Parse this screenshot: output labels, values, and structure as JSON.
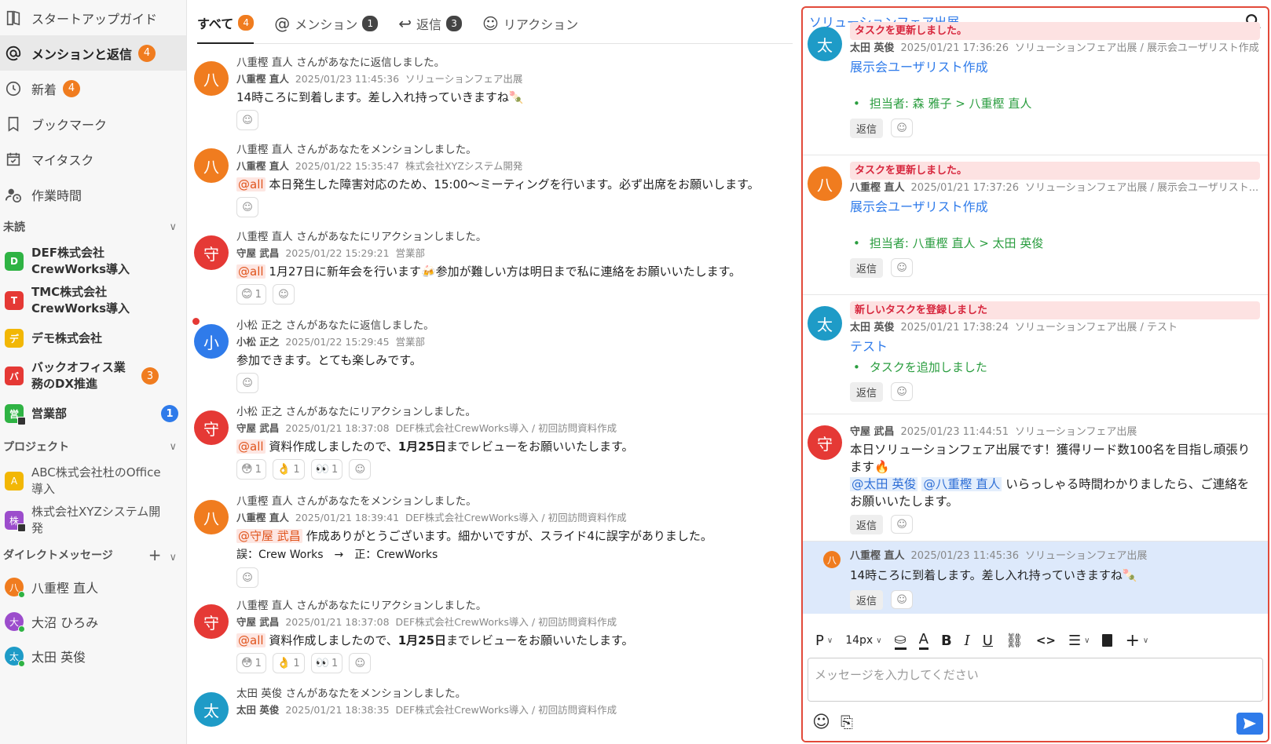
{
  "sidebar": {
    "nav": [
      {
        "label": "スタートアップガイド",
        "icon": "book-icon"
      },
      {
        "label": "メンションと返信",
        "icon": "at-icon",
        "badge": "4",
        "active": true
      },
      {
        "label": "新着",
        "icon": "clock-icon",
        "badge": "4"
      },
      {
        "label": "ブックマーク",
        "icon": "bookmark-icon"
      },
      {
        "label": "マイタスク",
        "icon": "calendar-check-icon"
      },
      {
        "label": "作業時間",
        "icon": "user-clock-icon"
      }
    ],
    "unread_section": "未読",
    "unread_channels": [
      {
        "initial": "D",
        "color": "#2fb344",
        "label": "DEF株式会社CrewWorks導入"
      },
      {
        "initial": "T",
        "color": "#e53935",
        "label": "TMC株式会社CrewWorks導入"
      },
      {
        "initial": "デ",
        "color": "#f2b705",
        "label": "デモ株式会社"
      },
      {
        "initial": "バ",
        "color": "#e53935",
        "label": "バックオフィス業務のDX推進",
        "badge": "3"
      },
      {
        "initial": "営",
        "color": "#2fb344",
        "label": "営業部",
        "badge_blue": "1",
        "locked": true
      }
    ],
    "project_section": "プロジェクト",
    "projects": [
      {
        "initial": "A",
        "color": "#f2b705",
        "label": "ABC株式会社杜のOffice導入"
      },
      {
        "initial": "株",
        "color": "#9c4dcc",
        "label": "株式会社XYZシステム開発",
        "locked": true
      }
    ],
    "dm_section": "ダイレクトメッセージ",
    "dms": [
      {
        "initial": "八",
        "color": "#f07c1f",
        "label": "八重樫 直人",
        "online": true
      },
      {
        "initial": "大",
        "color": "#9c4dcc",
        "label": "大沼 ひろみ",
        "online": true
      },
      {
        "initial": "太",
        "color": "#1e9bc7",
        "label": "太田 英俊",
        "online": true
      }
    ]
  },
  "tabs": [
    {
      "label": "すべて",
      "badge": "4",
      "icon": "",
      "active": true
    },
    {
      "label": "メンション",
      "badge": "1",
      "icon": "@"
    },
    {
      "label": "返信",
      "badge": "3",
      "icon": "↩"
    },
    {
      "label": "リアクション",
      "badge": "",
      "icon": "☺"
    }
  ],
  "feed": [
    {
      "avatar": "八",
      "color": "#f07c1f",
      "head": "八重樫 直人 さんがあなたに返信しました。",
      "author": "八重樫 直人",
      "date": "2025/01/23 11:45:36",
      "channel": "ソリューションフェア出展",
      "mention": "",
      "body": "14時ころに到着します。差し入れ持っていきますね🍡",
      "reactions": []
    },
    {
      "avatar": "八",
      "color": "#f07c1f",
      "head": "八重樫 直人 さんがあなたをメンションしました。",
      "author": "八重樫 直人",
      "date": "2025/01/22 15:35:47",
      "channel": "株式会社XYZシステム開発",
      "mention": "@all",
      "body": "本日発生した障害対応のため、15:00～ミーティングを行います。必ず出席をお願いします。",
      "reactions": []
    },
    {
      "avatar": "守",
      "color": "#e53935",
      "head": "八重樫 直人 さんがあなたにリアクションしました。",
      "author": "守屋 武昌",
      "date": "2025/01/22 15:29:21",
      "channel": "営業部",
      "mention": "@all",
      "body": "1月27日に新年会を行います🍻参加が難しい方は明日まで私に連絡をお願いいたします。",
      "reactions": [
        {
          "emoji": "😊",
          "count": "1"
        }
      ]
    },
    {
      "avatar": "小",
      "color": "#2f7bea",
      "unread": true,
      "head": "小松 正之 さんがあなたに返信しました。",
      "author": "小松 正之",
      "date": "2025/01/22 15:29:45",
      "channel": "営業部",
      "mention": "",
      "body": "参加できます。とても楽しみです。",
      "reactions": []
    },
    {
      "avatar": "守",
      "color": "#e53935",
      "head": "小松 正之 さんがあなたにリアクションしました。",
      "author": "守屋 武昌",
      "date": "2025/01/21 18:37:08",
      "channel": "DEF株式会社CrewWorks導入 / 初回訪問資料作成",
      "mention": "@all",
      "body_pre": "資料作成しましたので、",
      "body_bold": "1月25日",
      "body_post": "までレビューをお願いいたします。",
      "reactions": [
        {
          "emoji": "😳",
          "count": "1"
        },
        {
          "emoji": "👌",
          "count": "1"
        },
        {
          "emoji": "👀",
          "count": "1"
        }
      ]
    },
    {
      "avatar": "八",
      "color": "#f07c1f",
      "head": "八重樫 直人 さんがあなたをメンションしました。",
      "author": "八重樫 直人",
      "date": "2025/01/21 18:39:41",
      "channel": "DEF株式会社CrewWorks導入 / 初回訪問資料作成",
      "mention": "@守屋 武昌",
      "body": "作成ありがとうございます。細かいですが、スライド4に誤字がありました。",
      "body2": "誤：Crew Works　→　正：CrewWorks",
      "reactions": []
    },
    {
      "avatar": "守",
      "color": "#e53935",
      "head": "八重樫 直人 さんがあなたにリアクションしました。",
      "author": "守屋 武昌",
      "date": "2025/01/21 18:37:08",
      "channel": "DEF株式会社CrewWorks導入 / 初回訪問資料作成",
      "mention": "@all",
      "body_pre": "資料作成しましたので、",
      "body_bold": "1月25日",
      "body_post": "までレビューをお願いいたします。",
      "reactions": [
        {
          "emoji": "😳",
          "count": "1"
        },
        {
          "emoji": "👌",
          "count": "1"
        },
        {
          "emoji": "👀",
          "count": "1"
        }
      ]
    },
    {
      "avatar": "太",
      "color": "#1e9bc7",
      "head": "太田 英俊 さんがあなたをメンションしました。",
      "author": "太田 英俊",
      "date": "2025/01/21 18:38:35",
      "channel": "DEF株式会社CrewWorks導入 / 初回訪問資料作成",
      "mention": "",
      "body": "",
      "reactions": []
    }
  ],
  "thread": {
    "title": "ソリューションフェア出展",
    "messages": [
      {
        "avatar": "太",
        "color": "#1e9bc7",
        "event": "タスクを更新しました。",
        "author": "太田 英俊",
        "date": "2025/01/21 17:36:26",
        "channel": "ソリューションフェア出展 / 展示会ユーザリスト作成",
        "link": "展示会ユーザリスト作成",
        "bullet": "担当者: 森 雅子 > 八重樫 直人"
      },
      {
        "avatar": "八",
        "color": "#f07c1f",
        "event": "タスクを更新しました。",
        "author": "八重樫 直人",
        "date": "2025/01/21 17:37:26",
        "channel": "ソリューションフェア出展 / 展示会ユーザリスト...",
        "link": "展示会ユーザリスト作成",
        "bullet": "担当者: 八重樫 直人 > 太田 英俊"
      },
      {
        "avatar": "太",
        "color": "#1e9bc7",
        "event": "新しいタスクを登録しました",
        "author": "太田 英俊",
        "date": "2025/01/21 17:38:24",
        "channel": "ソリューションフェア出展 / テスト",
        "link": "テスト",
        "bullet": "タスクを追加しました"
      }
    ],
    "post": {
      "avatar": "守",
      "color": "#e53935",
      "author": "守屋 武昌",
      "date": "2025/01/23 11:44:51",
      "channel": "ソリューションフェア出展",
      "body": "本日ソリューションフェア出展です！獲得リード数100名を目指し頑張ります🔥",
      "mention1": "@太田 英俊",
      "mention2": "@八重樫 直人",
      "body2": "いらっしゃる時間わかりましたら、ご連絡をお願いいたします。"
    },
    "reply": {
      "avatar": "八",
      "color": "#f07c1f",
      "author": "八重樫 直人",
      "date": "2025/01/23 11:45:36",
      "channel": "ソリューションフェア出展",
      "body": "14時ころに到着します。差し入れ持っていきますね🍡"
    },
    "reply_label": "返信",
    "composer": {
      "format": "P",
      "font_size": "14px",
      "placeholder": "メッセージを入力してください"
    }
  }
}
